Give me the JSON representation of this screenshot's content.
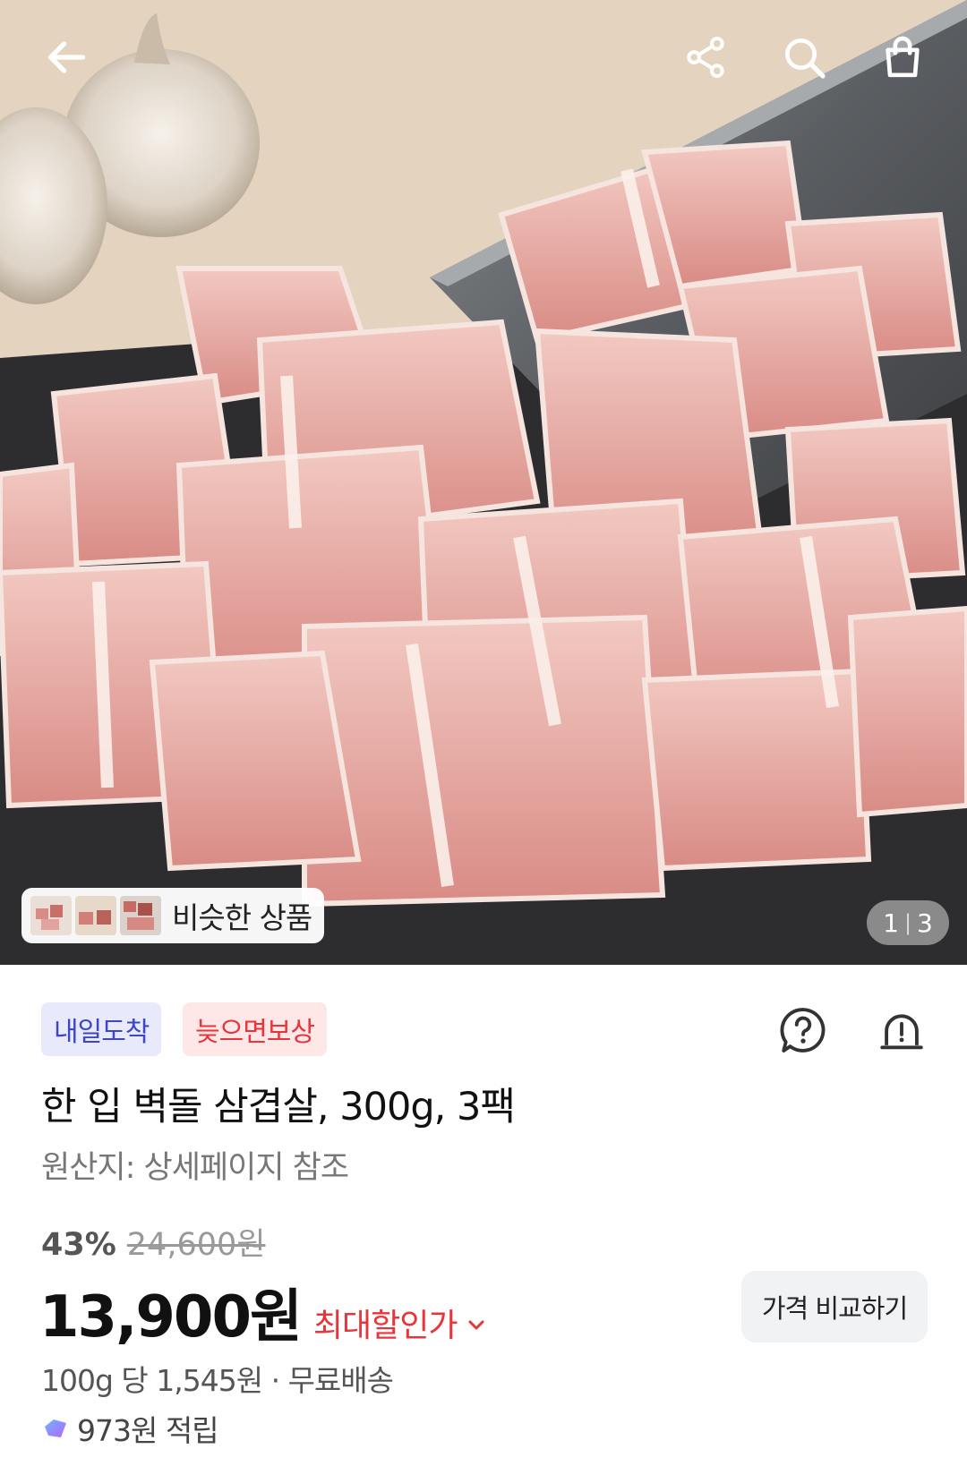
{
  "hero": {
    "similar_label": "비슷한 상품",
    "pager_current": "1",
    "pager_total": "3"
  },
  "icons": {
    "back": "arrow-left-icon",
    "share": "share-icon",
    "search": "search-icon",
    "cart": "shopping-bag-icon",
    "question": "question-bubble-icon",
    "report": "alert-siren-icon",
    "points": "points-gem-icon"
  },
  "product": {
    "badges": [
      "내일도착",
      "늦으면보상"
    ],
    "title": "한 입 벽돌 삼겹살, 300g, 3팩",
    "origin": "원산지: 상세페이지 참조",
    "discount_rate": "43%",
    "original_price": "24,600원",
    "price": "13,900원",
    "max_discount_label": "최대할인가",
    "compare_button": "가격 비교하기",
    "unit_price_shipping": "100g 당 1,545원 · 무료배송",
    "points": "973원 적립"
  },
  "colors": {
    "badge_blue_bg": "#e8eafc",
    "badge_blue_text": "#3b47c7",
    "badge_red_bg": "#fde7e7",
    "accent_red": "#e8343a"
  }
}
